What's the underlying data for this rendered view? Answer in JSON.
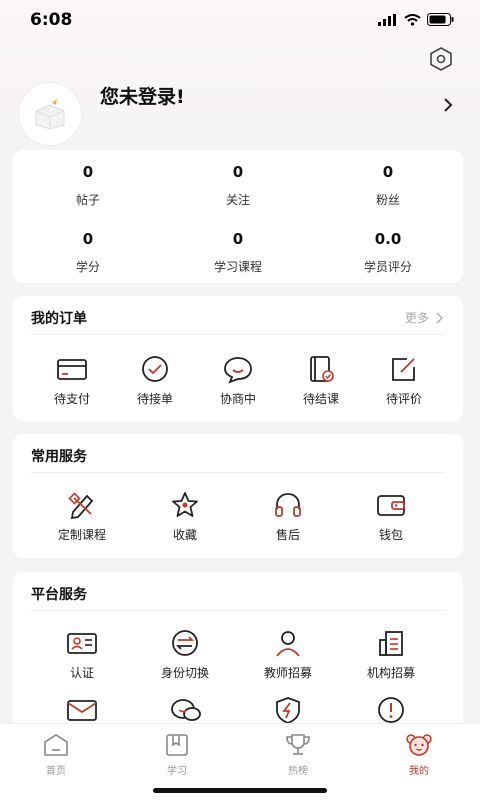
{
  "status": {
    "time": "6:08"
  },
  "profile": {
    "login_prompt": "您未登录!"
  },
  "stats": [
    {
      "value": "0",
      "label": "帖子"
    },
    {
      "value": "0",
      "label": "关注"
    },
    {
      "value": "0",
      "label": "粉丝"
    },
    {
      "value": "0",
      "label": "学分"
    },
    {
      "value": "0",
      "label": "学习课程"
    },
    {
      "value": "0.0",
      "label": "学员评分"
    }
  ],
  "orders": {
    "title": "我的订单",
    "more": "更多",
    "items": [
      {
        "label": "待支付",
        "icon": "card-icon"
      },
      {
        "label": "待接单",
        "icon": "check-circle-icon"
      },
      {
        "label": "协商中",
        "icon": "chat-bubble-icon"
      },
      {
        "label": "待结课",
        "icon": "book-check-icon"
      },
      {
        "label": "待评价",
        "icon": "edit-icon"
      }
    ]
  },
  "services": {
    "title": "常用服务",
    "items": [
      {
        "label": "定制课程",
        "icon": "pencil-ruler-icon"
      },
      {
        "label": "收藏",
        "icon": "star-icon"
      },
      {
        "label": "售后",
        "icon": "headphones-icon"
      },
      {
        "label": "钱包",
        "icon": "wallet-icon"
      }
    ]
  },
  "platform": {
    "title": "平台服务",
    "items": [
      {
        "label": "认证",
        "icon": "id-card-icon"
      },
      {
        "label": "身份切换",
        "icon": "switch-icon"
      },
      {
        "label": "教师招募",
        "icon": "person-icon"
      },
      {
        "label": "机构招募",
        "icon": "building-icon"
      },
      {
        "label": "",
        "icon": "mail-icon"
      },
      {
        "label": "",
        "icon": "chat-icon"
      },
      {
        "label": "",
        "icon": "shield-icon"
      },
      {
        "label": "",
        "icon": "alert-icon"
      }
    ]
  },
  "tabs": [
    {
      "label": "首页",
      "icon": "home-icon"
    },
    {
      "label": "学习",
      "icon": "study-book-icon"
    },
    {
      "label": "热榜",
      "icon": "trophy-icon"
    },
    {
      "label": "我的",
      "icon": "bear-icon"
    }
  ],
  "colors": {
    "accent": "#c0392b",
    "background": "#f4f4f4",
    "card": "#ffffff"
  }
}
